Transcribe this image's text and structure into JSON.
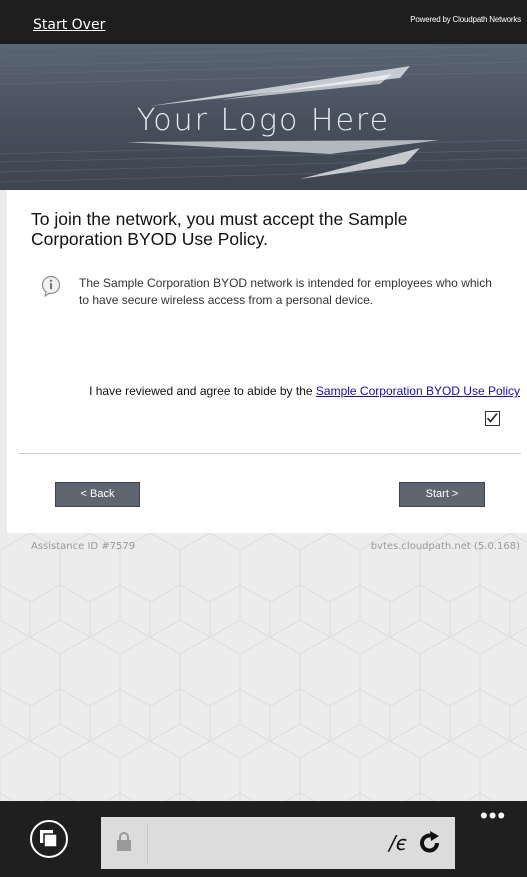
{
  "header": {
    "start_over": "Start Over",
    "powered_by": "Powered by Cloudpath Networks"
  },
  "banner": {
    "logo_text": "Your Logo Here"
  },
  "policy": {
    "heading": "To join the network, you must accept the Sample Corporation BYOD Use Policy.",
    "info": "The Sample Corporation BYOD network is intended for employees who which to have secure wireless access from a personal device.",
    "agree_prefix": "I have reviewed and agree to abide by the ",
    "agree_link": "Sample Corporation BYOD Use Policy",
    "agree_checked": true
  },
  "nav": {
    "back_label": "< Back",
    "start_label": "Start >"
  },
  "footer": {
    "assistance_id": "Assistance ID #7579",
    "server": "bvtes.cloudpath.net (5.0.168)"
  },
  "browser": {
    "address_text": "/є",
    "more": "•••"
  },
  "colors": {
    "topbar": "#1e1e1e",
    "banner": "#4f5866",
    "button": "#5f6670",
    "link": "#1a0dab",
    "appbar": "#1f1f1f"
  }
}
